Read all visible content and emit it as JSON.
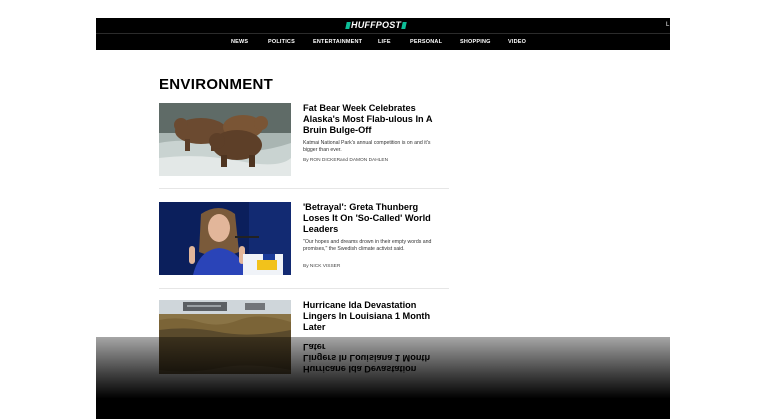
{
  "header": {
    "logo_text": "HUFFPOST",
    "corner_text": "L"
  },
  "nav": {
    "items": [
      {
        "label": "NEWS"
      },
      {
        "label": "POLITICS"
      },
      {
        "label": "ENTERTAINMENT"
      },
      {
        "label": "LIFE"
      },
      {
        "label": "PERSONAL"
      },
      {
        "label": "SHOPPING"
      },
      {
        "label": "VIDEO"
      }
    ]
  },
  "section": {
    "title": "ENVIRONMENT"
  },
  "articles": [
    {
      "title": "Fat Bear Week Celebrates Alaska's Most Flab-ulous In A Bruin Bulge-Off",
      "description": "Katmai National Park's annual competition is on and it's bigger than ever.",
      "byline": "By RON DICKERand DAMON DAHLEN",
      "image_icon": "bear-photo"
    },
    {
      "title": "'Betrayal': Greta Thunberg Loses It On 'So-Called' World Leaders",
      "description": "\"Our hopes and dreams drown in their empty words and promises,\" the Swedish climate activist said.",
      "byline": "By NICK VISSER",
      "image_icon": "speaker-photo"
    },
    {
      "title": "Hurricane Ida Devastation Lingers In Louisiana 1 Month Later",
      "image_icon": "flood-debris-photo"
    }
  ],
  "colors": {
    "brand_accent": "#0dbe98",
    "bar_background": "#000000"
  }
}
